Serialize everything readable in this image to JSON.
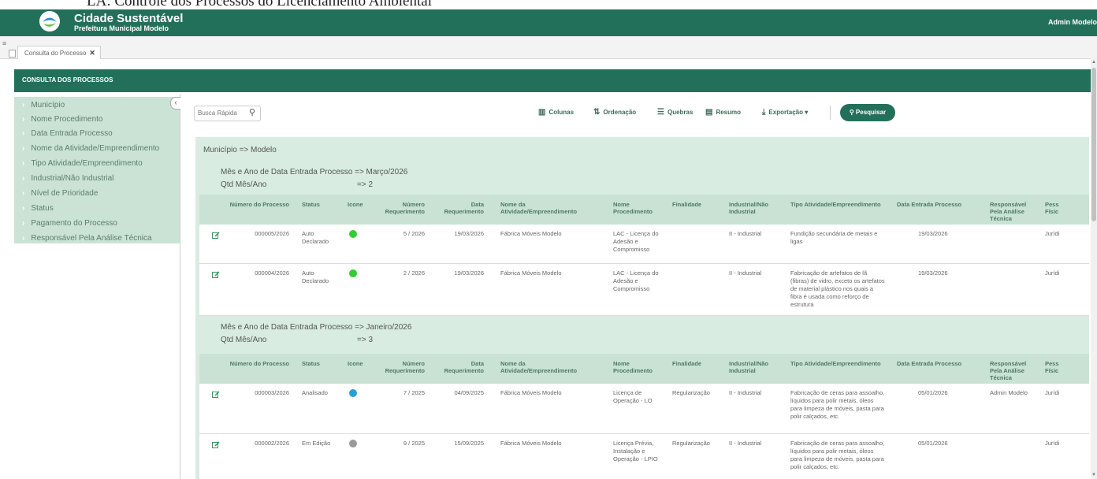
{
  "caption": "LA: Controle dos Processos do Licenciamento Ambiental",
  "header": {
    "app_title": "Cidade Sustentável",
    "app_subtitle": "Prefeitura Municipal Modelo",
    "user": "Admin Modelo",
    "brand_color": "#23705a"
  },
  "tabs": [
    {
      "label": "Consulta do Processo",
      "close": "✕"
    }
  ],
  "section_title": "CONSULTA DOS PROCESSOS",
  "sidebar": {
    "collapse_icon": "‹",
    "items": [
      "Município",
      "Nome Procedimento",
      "Data Entrada Processo",
      "Nome da Atividade/Empreendimento",
      "Tipo Atividade/Empreendimento",
      "Industrial/Não Industrial",
      "Nível de Prioridade",
      "Status",
      "Pagamento do Processo",
      "Responsável Pela Análise Técnica"
    ]
  },
  "toolbar": {
    "search_placeholder": "Busca Rápida",
    "buttons": {
      "columns": "Colunas",
      "ordering": "Ordenação",
      "breaks": "Quebras",
      "summary": "Resumo",
      "export": "Exportação"
    },
    "search_button": "Pesquisar"
  },
  "grouping": {
    "level1": "Município => Modelo",
    "group1": {
      "label": "Mês e Ano de Data Entrada Processo => Março/2026",
      "count_label": "Qtd Mês/Ano",
      "count_value": "=> 2"
    },
    "group2": {
      "label": "Mês e Ano de Data Entrada Processo => Janeiro/2026",
      "count_label": "Qtd Mês/Ano",
      "count_value": "=> 3"
    }
  },
  "columns": {
    "numero": "Número do Processo",
    "status": "Status",
    "icone": "Icone",
    "num_req": "Número Requerimento",
    "data_req": "Data Requerimento",
    "atividade": "Nome da Atividade/Empreendimento",
    "procedimento": "Nome Procedimento",
    "finalidade": "Finalidade",
    "industrial": "Industrial/Não Industrial",
    "tipo": "Tipo Atividade/Empreendimento",
    "data_entrada": "Data Entrada Processo",
    "responsavel": "Responsável Pela Análise Técnica",
    "pessoa": "Pess Físic"
  },
  "status_colors": {
    "green": "#33cc33",
    "blue": "#2a9fd6",
    "gray": "#9a9a9a"
  },
  "rows": [
    {
      "numero": "000005/2026",
      "status": "Auto Declarado",
      "icone": "green",
      "num_req": "5 / 2026",
      "data_req": "19/03/2026",
      "atividade": "Fábrica Móveis Modelo",
      "procedimento": "LAC - Licença do Adesão e Compromisso",
      "finalidade": "",
      "industrial": "II - Industrial",
      "tipo": "Fundição secundária de metais e ligas",
      "data_entrada": "19/03/2026",
      "responsavel": "",
      "pessoa": "Jurídi"
    },
    {
      "numero": "000004/2026",
      "status": "Auto Declarado",
      "icone": "green",
      "num_req": "2 / 2026",
      "data_req": "19/03/2026",
      "atividade": "Fábrica Móveis Modelo",
      "procedimento": "LAC - Licença do Adesão e Compromisso",
      "finalidade": "",
      "industrial": "II - Industrial",
      "tipo": "Fabricação de artefatos de lã (fibras) de vidro, exceto os artefatos de material plástico nos quais a fibra é usada como reforço de estrutura",
      "data_entrada": "19/03/2026",
      "responsavel": "",
      "pessoa": "Jurídi"
    },
    {
      "numero": "000003/2026",
      "status": "Analisado",
      "icone": "blue",
      "num_req": "7 / 2025",
      "data_req": "04/09/2025",
      "atividade": "Fábrica Móveis Modelo",
      "procedimento": "Licença de Operação - LO",
      "finalidade": "Regularização",
      "industrial": "II - Industrial",
      "tipo": "Fabricação de ceras para assoalho, líquidos para polir metais, óleos para limpeza de móveis, pasta para polir calçados, etc.",
      "data_entrada": "05/01/2026",
      "responsavel": "Admin Modelo",
      "pessoa": "Jurídi"
    },
    {
      "numero": "000002/2026",
      "status": "Em Edição",
      "icone": "gray",
      "num_req": "9 / 2025",
      "data_req": "15/09/2025",
      "atividade": "Fábrica Móveis Modelo",
      "procedimento": "Licença Prévia, Instalação e Operação - LPIO",
      "finalidade": "Regularização",
      "industrial": "II - Industrial",
      "tipo": "Fabricação de ceras para assoalho, líquidos para polir metais, óleos para limpeza de móveis, pasta para polir calçados, etc.",
      "data_entrada": "05/01/2026",
      "responsavel": "",
      "pessoa": "Jurídi"
    }
  ]
}
